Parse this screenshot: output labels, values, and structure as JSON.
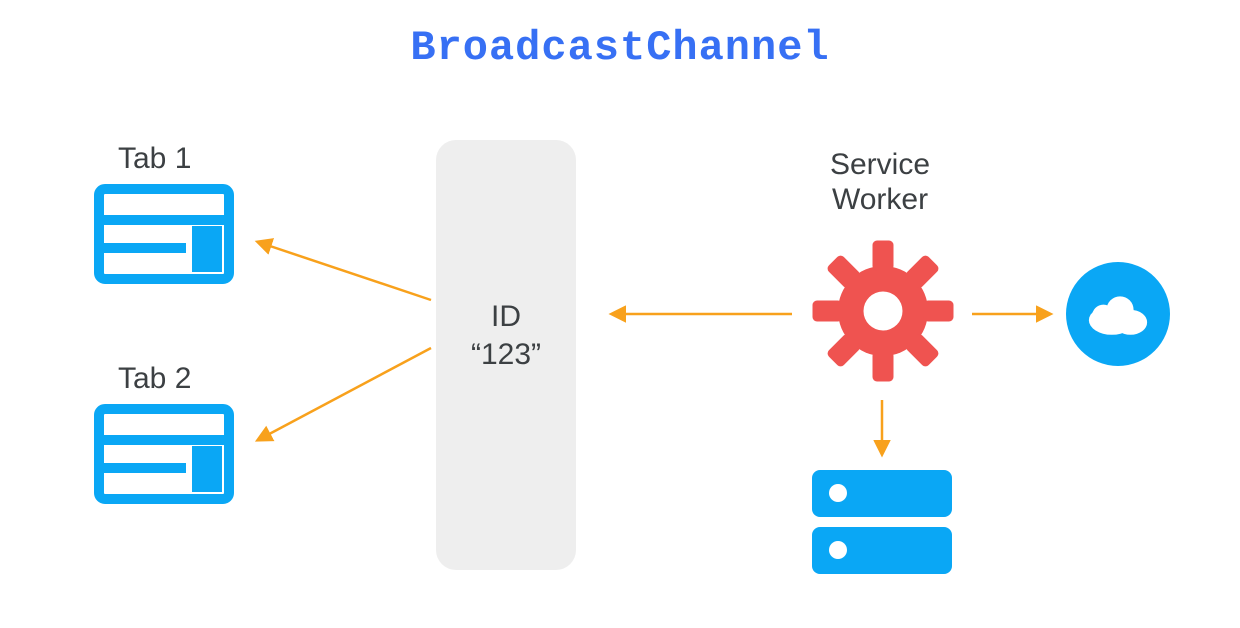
{
  "title": "BroadcastChannel",
  "labels": {
    "tab1": "Tab 1",
    "tab2": "Tab 2",
    "service_worker_line1": "Service",
    "service_worker_line2": "Worker"
  },
  "channel": {
    "id_label": "ID",
    "id_value": "“123”"
  },
  "icons": {
    "tab1": "window-tab-icon",
    "tab2": "window-tab-icon",
    "service_worker": "gear-icon",
    "cloud": "cloud-icon",
    "storage": "server-stack-icon"
  },
  "colors": {
    "title": "#3770f4",
    "accent_blue": "#0aa7f5",
    "gear_red": "#ef5350",
    "arrow_orange": "#f8a11c",
    "channel_bg": "#eeeeee",
    "text": "#3c4043"
  },
  "arrows": [
    {
      "from": "channel",
      "to": "tab1"
    },
    {
      "from": "channel",
      "to": "tab2"
    },
    {
      "from": "service_worker",
      "to": "channel"
    },
    {
      "from": "service_worker",
      "to": "cloud"
    },
    {
      "from": "service_worker",
      "to": "storage"
    }
  ]
}
